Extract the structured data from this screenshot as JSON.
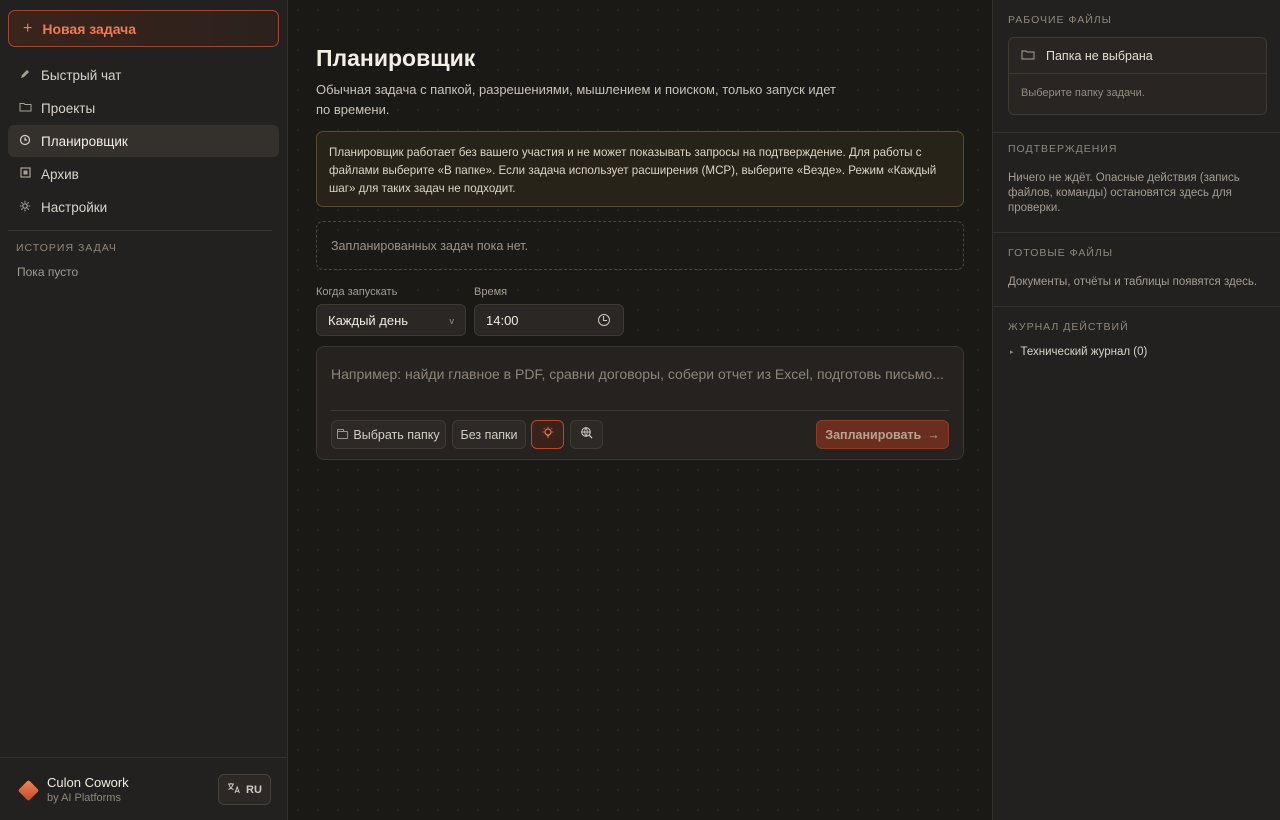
{
  "sidebar": {
    "new_task_label": "Новая задача",
    "nav": [
      {
        "label": "Быстрый чат",
        "icon": "pencil-icon"
      },
      {
        "label": "Проекты",
        "icon": "folder-icon"
      },
      {
        "label": "Планировщик",
        "icon": "clock-icon",
        "active": true
      },
      {
        "label": "Архив",
        "icon": "archive-icon"
      },
      {
        "label": "Настройки",
        "icon": "gear-icon"
      }
    ],
    "history_title": "ИСТОРИЯ ЗАДАЧ",
    "history_empty": "Пока пусто",
    "brand_name": "Culon Cowork",
    "brand_sub": "by AI Platforms",
    "lang_label": "RU"
  },
  "main": {
    "title": "Планировщик",
    "description": "Обычная задача с папкой, разрешениями, мышлением и поиском, только запуск идет по времени.",
    "notice": "Планировщик работает без вашего участия и не может показывать запросы на подтверждение. Для работы с файлами выберите «В папке». Если задача использует расширения (MCP), выберите «Везде». Режим «Каждый шаг» для таких задач не подходит.",
    "empty_scheduled": "Запланированных задач пока нет.",
    "when_label": "Когда запускать",
    "when_value": "Каждый день",
    "time_label": "Время",
    "time_value": "14:00",
    "composer_placeholder": "Например: найди главное в PDF, сравни договоры, собери отчет из Excel, подготовь письмо...",
    "choose_folder_label": "Выбрать папку",
    "no_folder_label": "Без папки",
    "schedule_label": "Запланировать"
  },
  "right": {
    "work_files_title": "РАБОЧИЕ ФАЙЛЫ",
    "folder_not_selected": "Папка не выбрана",
    "folder_hint": "Выберите папку задачи.",
    "confirm_title": "ПОДТВЕРЖДЕНИЯ",
    "confirm_text": "Ничего не ждёт. Опасные действия (запись файлов, команды) остановятся здесь для проверки.",
    "ready_title": "ГОТОВЫЕ ФАЙЛЫ",
    "ready_text": "Документы, отчёты и таблицы появятся здесь.",
    "log_title": "ЖУРНАЛ ДЕЙСТВИЙ",
    "tech_log": "Технический журнал (0)"
  },
  "colors": {
    "accent": "#f07a55",
    "accent_border": "#a4452f",
    "background": "#1b1916",
    "panel": "#232120"
  }
}
